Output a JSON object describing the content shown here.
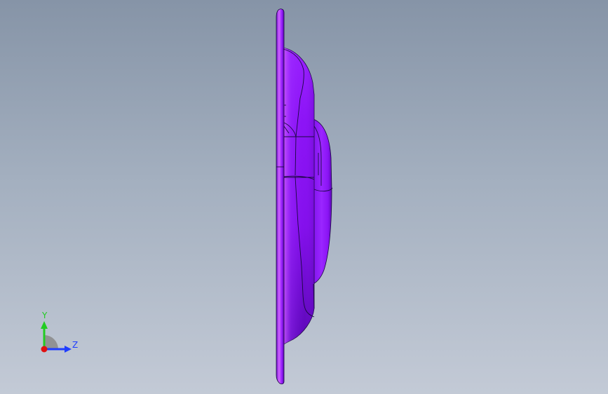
{
  "viewport": {
    "background_top": "#8694a7",
    "background_bottom": "#c3cad6"
  },
  "model": {
    "description_name": "dish-part",
    "color": "#8a10f4",
    "highlight_color": "#d060ff",
    "shadow_color": "#4e06a8",
    "edge_color": "#1a0840"
  },
  "triad": {
    "y_label": "Y",
    "z_label": "Z",
    "y_color": "#22cc22",
    "z_color": "#1f3dff",
    "x_color": "#e01010"
  }
}
